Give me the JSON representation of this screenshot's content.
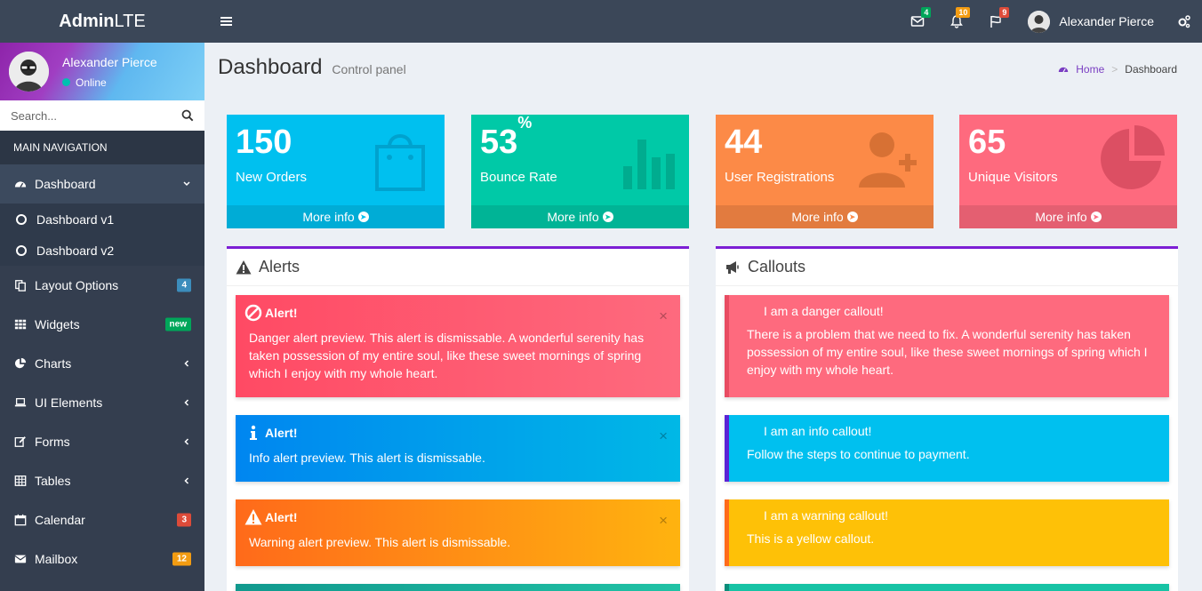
{
  "header": {
    "logo_bold": "Admin",
    "logo_light": "LTE",
    "messages_count": "4",
    "notifications_count": "10",
    "tasks_count": "9",
    "user_name": "Alexander Pierce",
    "colors": {
      "bar": "#3b4758",
      "green": "#00a65a",
      "orange": "#f39c12",
      "red": "#dd4b39"
    }
  },
  "sidebar": {
    "user_name": "Alexander Pierce",
    "user_status": "Online",
    "search_placeholder": "Search...",
    "nav_header": "MAIN NAVIGATION",
    "items": [
      {
        "label": "Dashboard",
        "icon": "dashboard-icon"
      },
      {
        "label": "Dashboard v1",
        "icon": "circle-icon"
      },
      {
        "label": "Dashboard v2",
        "icon": "circle-icon"
      },
      {
        "label": "Layout Options",
        "icon": "files-icon",
        "badge": "4",
        "badge_color": "#3c8dbc"
      },
      {
        "label": "Widgets",
        "icon": "th-icon",
        "badge": "new",
        "badge_color": "#00a65a"
      },
      {
        "label": "Charts",
        "icon": "pie-chart-icon"
      },
      {
        "label": "UI Elements",
        "icon": "laptop-icon"
      },
      {
        "label": "Forms",
        "icon": "edit-icon"
      },
      {
        "label": "Tables",
        "icon": "table-icon"
      },
      {
        "label": "Calendar",
        "icon": "calendar-icon",
        "badge": "3",
        "badge_color": "#dd4b39"
      },
      {
        "label": "Mailbox",
        "icon": "envelope-icon",
        "badge": "12",
        "badge_color": "#f39c12"
      }
    ]
  },
  "page": {
    "title": "Dashboard",
    "subtitle": "Control panel",
    "breadcrumb_home": "Home",
    "breadcrumb_current": "Dashboard"
  },
  "stat_boxes": [
    {
      "value": "150",
      "suffix": "",
      "label": "New Orders",
      "more": "More info",
      "color": "#00c0ef",
      "icon": "shopping-bag-icon"
    },
    {
      "value": "53",
      "suffix": "%",
      "label": "Bounce Rate",
      "more": "More info",
      "color": "#00c9a7",
      "icon": "bar-chart-icon"
    },
    {
      "value": "44",
      "suffix": "",
      "label": "User Registrations",
      "more": "More info",
      "color": "#fc8a47",
      "icon": "user-add-icon"
    },
    {
      "value": "65",
      "suffix": "",
      "label": "Unique Visitors",
      "more": "More info",
      "color": "#fe6a7e",
      "icon": "pie-chart-icon"
    }
  ],
  "alerts_panel": {
    "title": "Alerts",
    "alerts": [
      {
        "title": "Alert!",
        "text": "Danger alert preview. This alert is dismissable. A wonderful serenity has taken possession of my entire soul, like these sweet mornings of spring which I enjoy with my whole heart.",
        "close": "×"
      },
      {
        "title": "Alert!",
        "text": "Info alert preview. This alert is dismissable.",
        "close": "×"
      },
      {
        "title": "Alert!",
        "text": "Warning alert preview. This alert is dismissable.",
        "close": "×"
      }
    ]
  },
  "callouts_panel": {
    "title": "Callouts",
    "callouts": [
      {
        "title": "I am a danger callout!",
        "text": "There is a problem that we need to fix. A wonderful serenity has taken possession of my entire soul, like these sweet mornings of spring which I enjoy with my whole heart."
      },
      {
        "title": "I am an info callout!",
        "text": "Follow the steps to continue to payment."
      },
      {
        "title": "I am a warning callout!",
        "text": "This is a yellow callout."
      }
    ]
  }
}
